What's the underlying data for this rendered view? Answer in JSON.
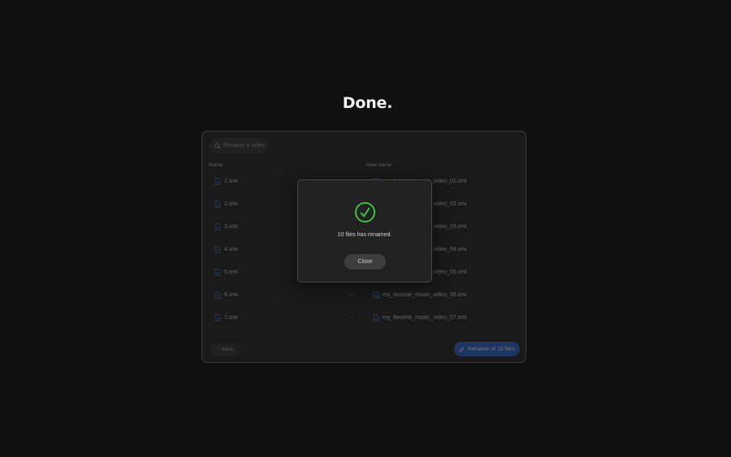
{
  "page": {
    "title": "Done."
  },
  "panel": {
    "search_placeholder": "Rename a video",
    "columns": {
      "name": "Name",
      "new_name": "New name"
    },
    "arrow": "→",
    "rows": [
      {
        "name": "1.smi",
        "new_name": "my_favorite_music_video_01.smi"
      },
      {
        "name": "2.smi",
        "new_name": "my_favorite_music_video_02.smi"
      },
      {
        "name": "3.smi",
        "new_name": "my_favorite_music_video_03.smi"
      },
      {
        "name": "4.smi",
        "new_name": "my_favorite_music_video_04.smi"
      },
      {
        "name": "5.smi",
        "new_name": "my_favorite_music_video_05.smi"
      },
      {
        "name": "6.smi",
        "new_name": "my_favorite_music_video_06.smi"
      },
      {
        "name": "7.smi",
        "new_name": "my_favorite_music_video_07.smi"
      }
    ],
    "back_label": "Back",
    "rename_label": "Rename of 10 files"
  },
  "modal": {
    "message": "10 files has renamed.",
    "close_label": "Close"
  },
  "colors": {
    "accent": "#2458c4",
    "success": "#3cc43c",
    "file_icon": "#3a6fd8"
  },
  "icons": {
    "search": "search-icon",
    "file": "file-icon",
    "back": "chevron-left-icon",
    "rename": "pencil-icon",
    "success": "check-circle-icon"
  }
}
